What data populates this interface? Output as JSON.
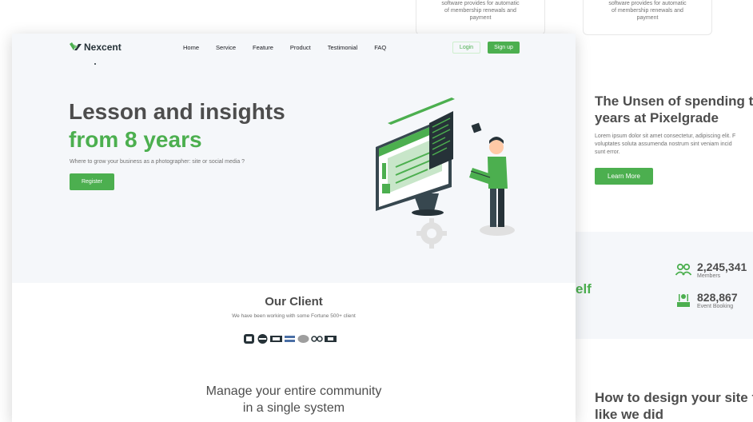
{
  "background_page": {
    "cards": [
      {
        "line1": "software provides for automatic",
        "line2": "of membership renewals and",
        "line3": "payment"
      },
      {
        "line1": "software provides for automatic",
        "line2": "of membership renewals and",
        "line3": "payment"
      }
    ],
    "section_title_line1": "The Unsen of spending thr",
    "section_title_line2": "years at Pixelgrade",
    "section_body_line1": "Lorem ipsum dolor sit amet consectetur, adipiscing elit. F",
    "section_body_line2": "voluptates soluta assumenda nostrum sint veniam incid",
    "section_body_line3": "sunt error.",
    "learn_more_label": "Learn More",
    "self_fragment": "elf",
    "stats": [
      {
        "number": "2,245,341",
        "label": "Members",
        "icon": "members-icon"
      },
      {
        "number": "828,867",
        "label": "Event Booking",
        "icon": "event-booking-icon"
      }
    ],
    "bottom_title_line1": "How to design your site fo",
    "bottom_title_line2": "like we did"
  },
  "navbar": {
    "logo_text": "Nexcent",
    "links": [
      "Home",
      "Service",
      "Feature",
      "Product",
      "Testimonial",
      "FAQ"
    ],
    "login_label": "Login",
    "signup_label": "Sign up"
  },
  "hero": {
    "title_line1": "Lesson and insights",
    "title_line2": "from 8 years",
    "subtitle": "Where to grow your business as a photographer: site or social media ?",
    "register_label": "Register"
  },
  "clients": {
    "title": "Our Client",
    "subtitle": "We have been working with some Fortune 500+ client"
  },
  "manage": {
    "title_line1": "Manage your entire community",
    "title_line2": "in a single system"
  },
  "colors": {
    "primary": "#4caf4f",
    "heading": "#4d4d4d",
    "muted": "#717171",
    "hero_bg": "#f5f7fa"
  }
}
